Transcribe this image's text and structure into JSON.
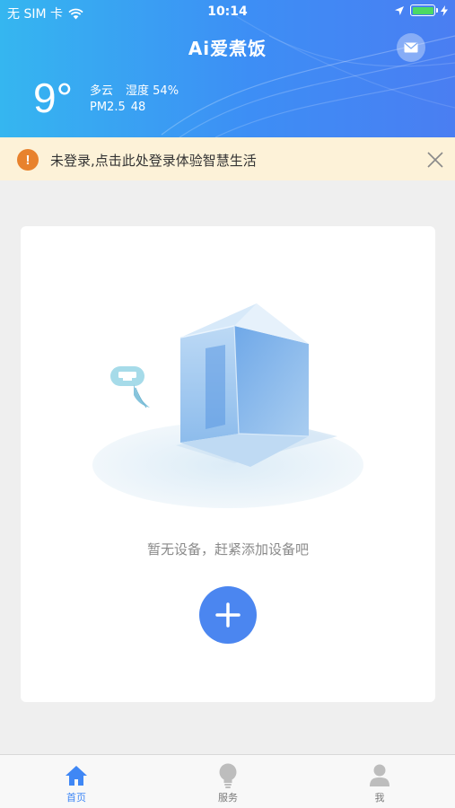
{
  "status_bar": {
    "carrier": "无 SIM 卡",
    "time": "10:14"
  },
  "header": {
    "title": "Ai爱煮饭"
  },
  "weather": {
    "temperature": "9°",
    "condition": "多云",
    "humidity": "湿度 54%",
    "pm_label": "PM2.5",
    "pm_value": "48"
  },
  "login_banner": {
    "text": "未登录,点击此处登录体验智慧生活",
    "icon": "!"
  },
  "main": {
    "empty_text": "暂无设备，赶紧添加设备吧"
  },
  "tabbar": {
    "items": [
      {
        "label": "首页"
      },
      {
        "label": "服务"
      },
      {
        "label": "我"
      }
    ]
  },
  "colors": {
    "accent": "#3f87f5",
    "banner_bg": "#fdf2d8",
    "warning": "#e8822d",
    "battery": "#4cd964"
  }
}
